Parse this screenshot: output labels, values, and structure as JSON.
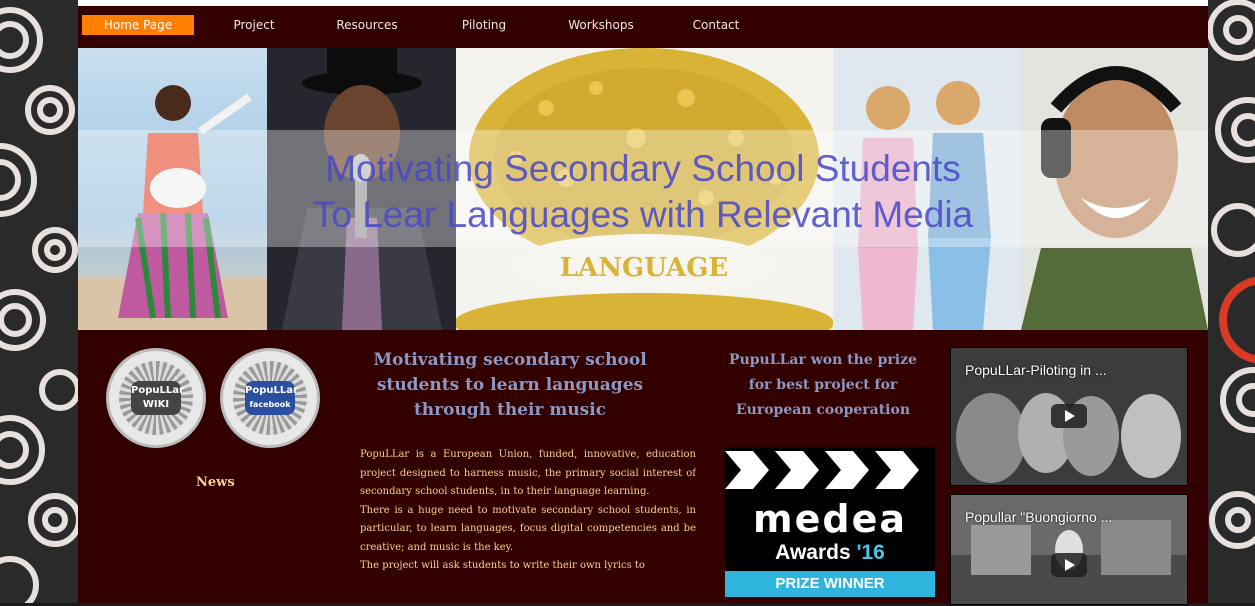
{
  "nav": {
    "items": [
      {
        "label": "Home Page",
        "active": true
      },
      {
        "label": "Project"
      },
      {
        "label": "Resources"
      },
      {
        "label": "Piloting"
      },
      {
        "label": "Workshops"
      },
      {
        "label": "Contact"
      }
    ]
  },
  "banner": {
    "title_line1": "Motivating Secondary School Students",
    "title_line2": "To Lear Languages with Relevant Media",
    "image_text": "LANGUAGE"
  },
  "sidebar": {
    "badge_wiki": {
      "line1": "PopuLLar",
      "line2": "WIKI"
    },
    "badge_facebook": {
      "line1": "PopuLLar",
      "line2": "facebook"
    },
    "news_label": "News"
  },
  "main": {
    "heading": "Motivating secondary school students to learn languages through their music",
    "paragraphs": [
      "PopuLLar is a European Union,   funded, innovative, education project designed to harness music, the primary social interest of secondary school students, in to their language learning.",
      "There is a huge need to motivate secondary school students, in particular, to learn languages, focus digital competencies and be creative; and music is the key.",
      "The project will ask students to write their own lyrics to"
    ]
  },
  "prize": {
    "heading": "PupuLLar won the prize for best project for European cooperation",
    "brand": "medea",
    "awards": "Awards",
    "year": "'16",
    "prize_text": "PRIZE WINNER"
  },
  "videos": [
    {
      "title": "PopuLLar-Piloting in ..."
    },
    {
      "title": "Popullar \"Buongiorno ..."
    }
  ],
  "colors": {
    "page_bg": "#330000",
    "nav_active": "#ff7f00",
    "heading": "#8d97c4",
    "body_text": "#f4d48a",
    "banner_title": "#4848c8"
  }
}
